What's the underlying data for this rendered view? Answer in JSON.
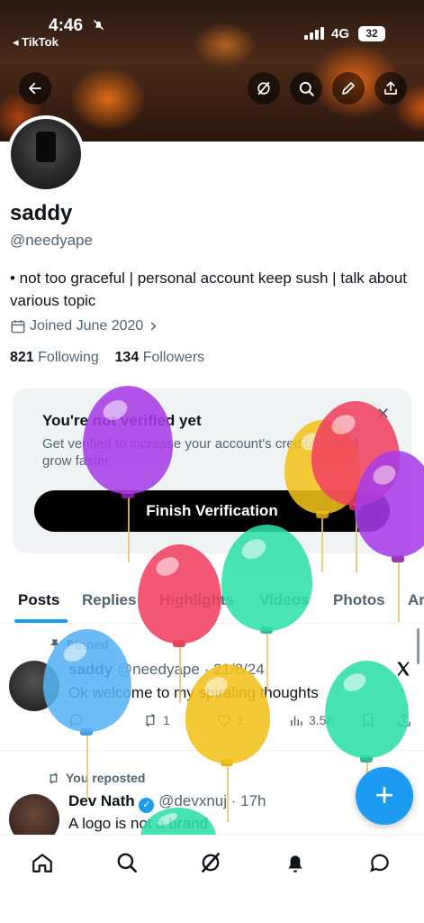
{
  "status_bar": {
    "time": "4:46",
    "back_app": "◂ TikTok",
    "network": "4G",
    "battery": "32"
  },
  "profile": {
    "name": "saddy",
    "handle": "@needyape",
    "bio": "• not too graceful | personal account keep sush | talk about various topic",
    "joined": "Joined June 2020",
    "following_count": "821",
    "following_label": "Following",
    "followers_count": "134",
    "followers_label": "Followers"
  },
  "verification": {
    "title": "You're not verified yet",
    "description": "Get verified to increase your account's credibility and grow faster.",
    "button": "Finish Verification"
  },
  "tabs": [
    "Posts",
    "Replies",
    "Highlights",
    "Videos",
    "Photos",
    "Articles"
  ],
  "posts": [
    {
      "pinned_label": "Pinned",
      "author": "saddy",
      "handle": "@needyape",
      "date": "· 21/8/24",
      "text": "Ok welcome to my spiraling thoughts",
      "reposts": "1",
      "likes": "1",
      "views": "3.5K"
    },
    {
      "repost_label": "You reposted",
      "author": "Dev Nath",
      "handle": "@devxnuj",
      "date": "· 17h",
      "text": "A logo is not a brand"
    }
  ],
  "colors": {
    "accent": "#1d9bf0",
    "text": "#0f1419",
    "muted": "#536471",
    "card": "#eff3f4"
  },
  "icons": [
    "back-arrow-icon",
    "grok-icon",
    "search-icon",
    "edit-icon",
    "share-icon",
    "calendar-icon",
    "chevron-right-icon",
    "close-icon",
    "pin-icon",
    "reply-icon",
    "repost-icon",
    "like-icon",
    "views-icon",
    "bookmark-icon",
    "verified-icon",
    "plus-icon",
    "home-icon",
    "notifications-icon",
    "messages-icon"
  ]
}
